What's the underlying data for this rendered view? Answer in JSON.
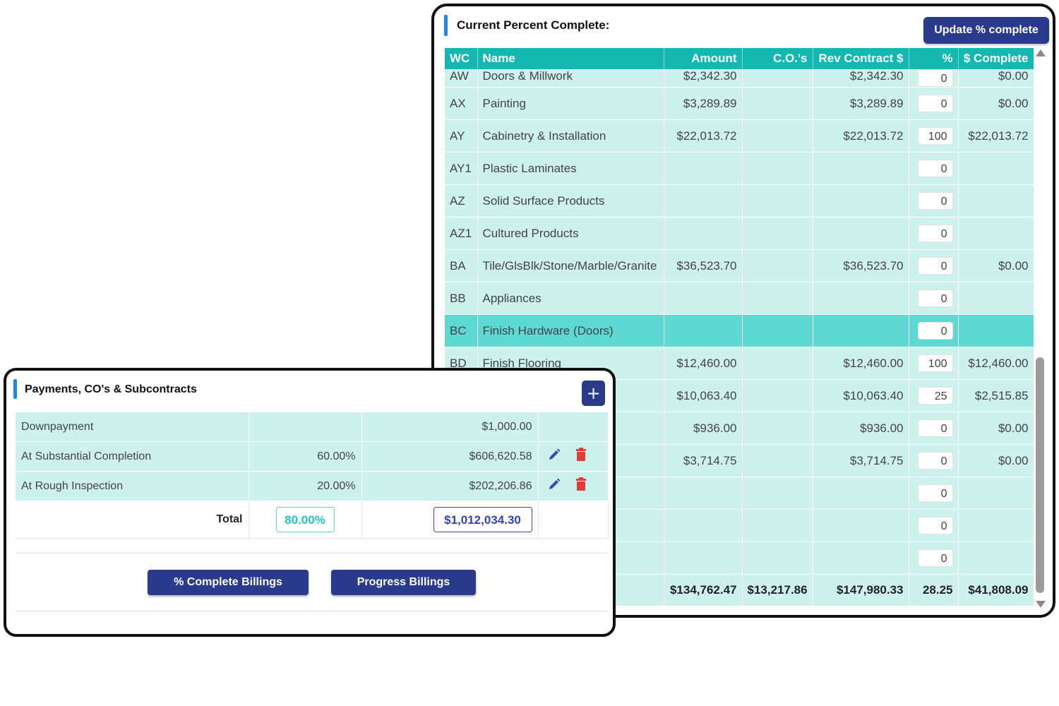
{
  "percent_panel": {
    "title": "Current Percent Complete:",
    "update_button": "Update % complete",
    "columns": [
      "WC",
      "Name",
      "Amount",
      "C.O.'s",
      "Rev Contract $",
      "%",
      "$ Complete"
    ],
    "rows": [
      {
        "wc": "AW",
        "name": "Doors & Millwork",
        "amount": "$2,342.30",
        "cos": "",
        "rev": "$2,342.30",
        "pct": "0",
        "complete": "$0.00"
      },
      {
        "wc": "AX",
        "name": "Painting",
        "amount": "$3,289.89",
        "cos": "",
        "rev": "$3,289.89",
        "pct": "0",
        "complete": "$0.00"
      },
      {
        "wc": "AY",
        "name": "Cabinetry & Installation",
        "amount": "$22,013.72",
        "cos": "",
        "rev": "$22,013.72",
        "pct": "100",
        "complete": "$22,013.72"
      },
      {
        "wc": "AY1",
        "name": "Plastic Laminates",
        "amount": "",
        "cos": "",
        "rev": "",
        "pct": "0",
        "complete": ""
      },
      {
        "wc": "AZ",
        "name": "Solid Surface Products",
        "amount": "",
        "cos": "",
        "rev": "",
        "pct": "0",
        "complete": ""
      },
      {
        "wc": "AZ1",
        "name": "Cultured Products",
        "amount": "",
        "cos": "",
        "rev": "",
        "pct": "0",
        "complete": ""
      },
      {
        "wc": "BA",
        "name": "Tile/GlsBlk/Stone/Marble/Granite",
        "amount": "$36,523.70",
        "cos": "",
        "rev": "$36,523.70",
        "pct": "0",
        "complete": "$0.00"
      },
      {
        "wc": "BB",
        "name": "Appliances",
        "amount": "",
        "cos": "",
        "rev": "",
        "pct": "0",
        "complete": ""
      },
      {
        "wc": "BC",
        "name": "Finish Hardware (Doors)",
        "amount": "",
        "cos": "",
        "rev": "",
        "pct": "0",
        "complete": ""
      },
      {
        "wc": "BD",
        "name": "Finish Flooring",
        "amount": "$12,460.00",
        "cos": "",
        "rev": "$12,460.00",
        "pct": "100",
        "complete": "$12,460.00"
      },
      {
        "wc": "",
        "name": "",
        "amount": "$10,063.40",
        "cos": "",
        "rev": "$10,063.40",
        "pct": "25",
        "complete": "$2,515.85"
      },
      {
        "wc": "",
        "name": "",
        "amount": "$936.00",
        "cos": "",
        "rev": "$936.00",
        "pct": "0",
        "complete": "$0.00"
      },
      {
        "wc": "",
        "name": "",
        "amount": "$3,714.75",
        "cos": "",
        "rev": "$3,714.75",
        "pct": "0",
        "complete": "$0.00"
      },
      {
        "wc": "",
        "name": "",
        "amount": "",
        "cos": "",
        "rev": "",
        "pct": "0",
        "complete": ""
      },
      {
        "wc": "",
        "name": "",
        "amount": "",
        "cos": "",
        "rev": "",
        "pct": "0",
        "complete": ""
      },
      {
        "wc": "",
        "name": "",
        "amount": "",
        "cos": "",
        "rev": "",
        "pct": "0",
        "complete": ""
      }
    ],
    "totals": {
      "amount": "$134,762.47",
      "cos": "$13,217.86",
      "rev": "$147,980.33",
      "pct": "28.25",
      "complete": "$41,808.09"
    }
  },
  "payments_panel": {
    "title": "Payments, CO's & Subcontracts",
    "add_icon": "+",
    "rows": [
      {
        "label": "Downpayment",
        "pct": "",
        "amount": "$1,000.00"
      },
      {
        "label": "At Substantial Completion",
        "pct": "60.00%",
        "amount": "$606,620.58"
      },
      {
        "label": "At Rough Inspection",
        "pct": "20.00%",
        "amount": "$202,206.86"
      }
    ],
    "total_label": "Total",
    "total_pct": "80.00%",
    "total_amount": "$1,012,034.30",
    "buttons": {
      "percent_billings": "% Complete Billings",
      "progress_billings": "Progress Billings"
    }
  },
  "colors": {
    "header_teal": "#14b8b0",
    "row_teal": "#cdf1ed",
    "highlight_teal": "#5ed8d2",
    "button_navy": "#2a3a8c",
    "accent_blue": "#1e88e5",
    "delete_red": "#e53935"
  },
  "icons": [
    "plus-icon",
    "pencil-icon",
    "trash-icon",
    "scroll-up-arrow-icon",
    "scroll-down-arrow-icon"
  ]
}
